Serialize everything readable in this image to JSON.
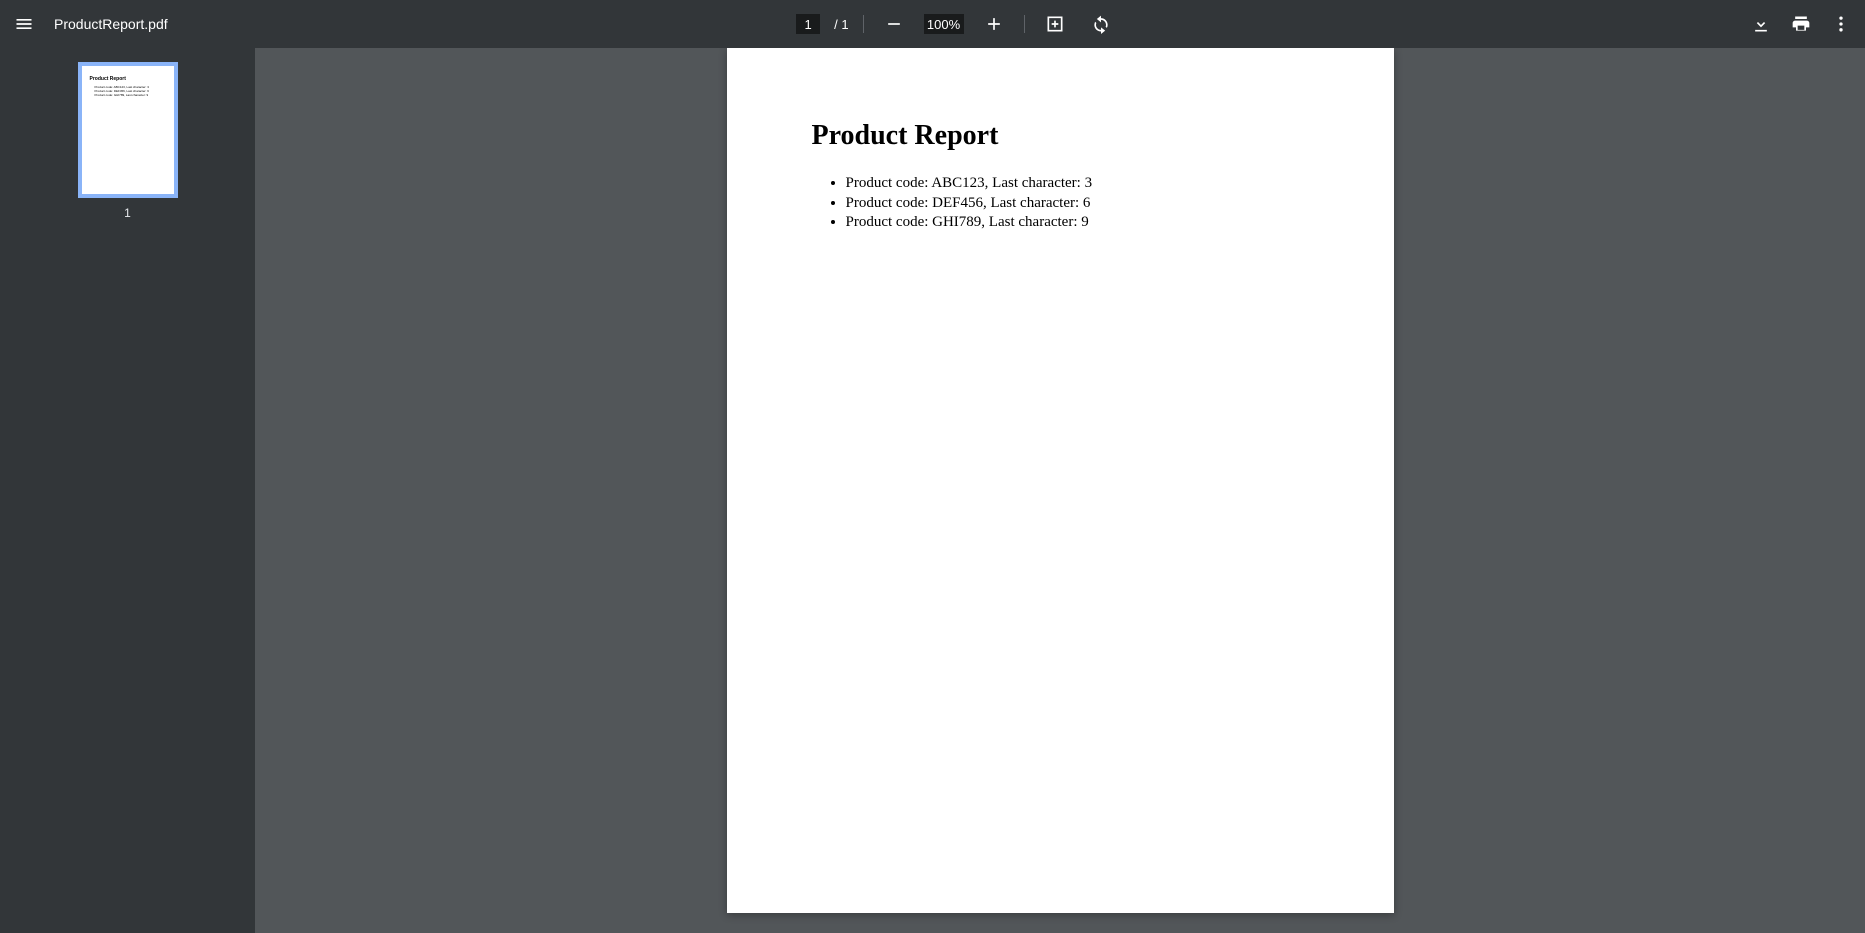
{
  "file": {
    "name": "ProductReport.pdf"
  },
  "pages": {
    "current": "1",
    "total": "1"
  },
  "zoom": {
    "level": "100%"
  },
  "thumbnail": {
    "label": "1"
  },
  "document": {
    "title": "Product Report",
    "items": [
      "Product code: ABC123, Last character: 3",
      "Product code: DEF456, Last character: 6",
      "Product code: GHI789, Last character: 9"
    ]
  }
}
